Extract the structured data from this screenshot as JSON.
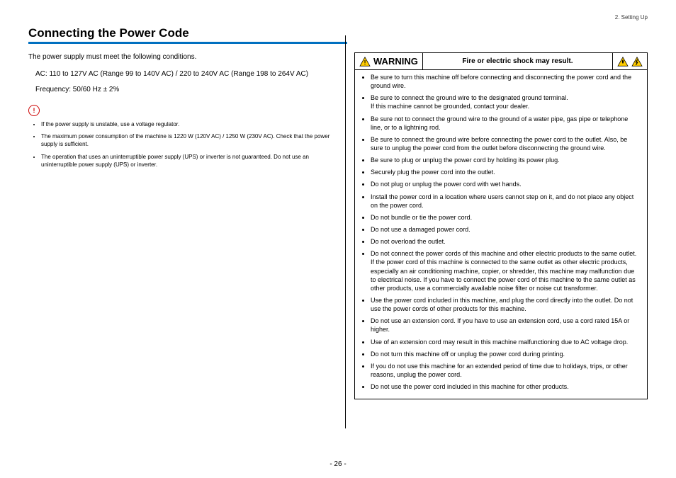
{
  "header": {
    "chapter": "2. Setting Up"
  },
  "title": "Connecting the Power Code",
  "left": {
    "intro": "The power supply must meet the following conditions.",
    "spec_ac": "AC: 110 to 127V AC (Range 99 to 140V AC) / 220 to 240V AC (Range 198 to 264V AC)",
    "spec_freq": "Frequency: 50/60 Hz ± 2%",
    "note_icon_label": "!",
    "notes": [
      "If the power supply is unstable, use a voltage regulator.",
      "The maximum power consumption of the machine is 1220 W (120V AC) / 1250 W (230V AC). Check that the power supply is sufficient.",
      "The operation that uses an uninterruptible power supply (UPS) or inverter is not guaranteed. Do not use an uninterruptible power supply (UPS) or inverter."
    ]
  },
  "warning": {
    "label": "WARNING",
    "subtitle": "Fire or electric shock may result.",
    "items": [
      "Be sure to turn this machine off before connecting and disconnecting the power cord and the ground wire.",
      "Be sure to connect the ground wire to the designated ground terminal.\nIf this machine cannot be grounded, contact your dealer.",
      "Be sure not to connect the ground wire to the ground of a water pipe, gas pipe or telephone line, or to a lightning rod.",
      "Be sure to connect the ground wire before connecting the power cord to the outlet. Also, be sure to unplug the power cord from the outlet before disconnecting the ground wire.",
      "Be sure to plug or unplug the power cord by holding its power plug.",
      "Securely plug the power cord into the outlet.",
      "Do not plug or unplug the power cord with wet hands.",
      "Install the power cord in a location where users cannot step on it, and do not place any object on the power cord.",
      "Do not bundle or tie the power cord.",
      "Do not use a damaged power cord.",
      "Do not overload the outlet.",
      "Do not connect the power cords of this machine and other electric products to the same outlet. If the power cord of this machine is connected to the same outlet as other electric products, especially an air conditioning machine, copier, or shredder, this machine may malfunction due to electrical noise. If you have to connect the power cord of this machine to the same outlet as other products, use a commercially available noise filter or noise cut transformer.",
      "Use the power cord included in this machine, and plug the cord directly into the outlet. Do not use the power cords of other products for this machine.",
      "Do not use an extension cord. If you have to use an extension cord, use a cord rated 15A or higher.",
      "Use of an extension cord may result in this machine malfunctioning due to AC voltage drop.",
      "Do not turn this machine off or unplug the power cord during printing.",
      "If you do not use this machine for an extended period of time due to holidays, trips, or other reasons, unplug the power cord.",
      "Do not use the power cord included in this machine for other products."
    ]
  },
  "page_number": "- 26 -"
}
